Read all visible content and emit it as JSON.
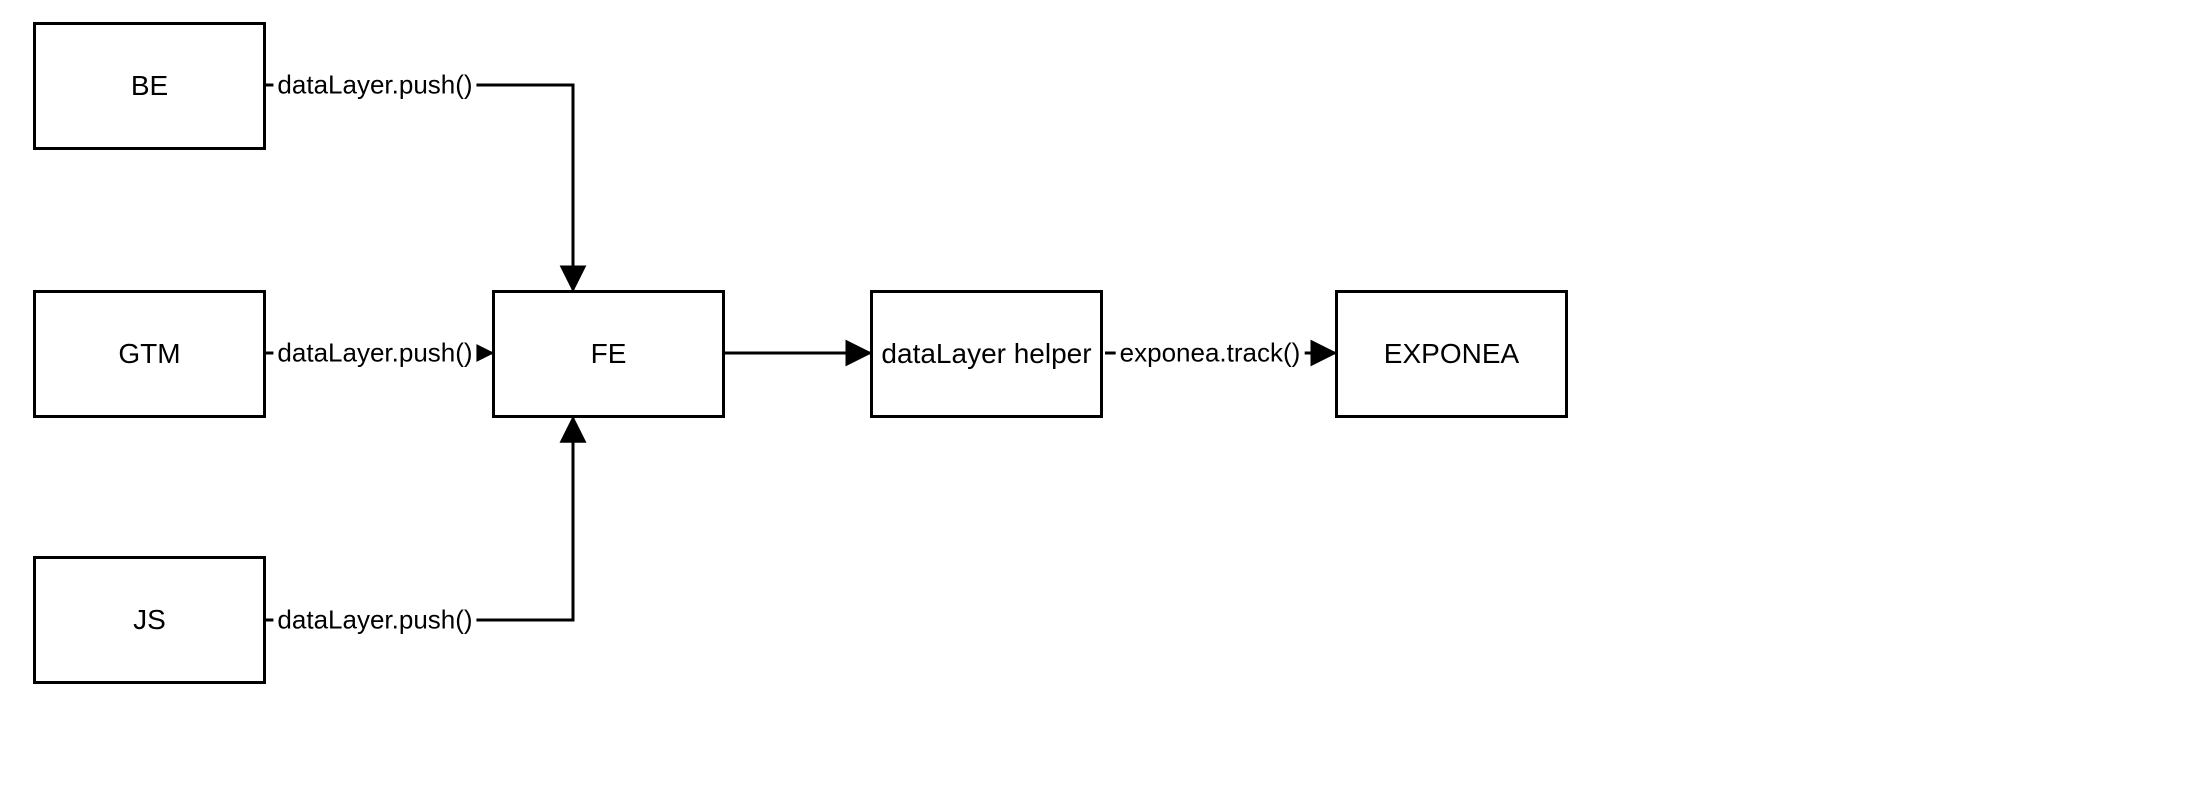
{
  "nodes": {
    "be": {
      "label": "BE"
    },
    "gtm": {
      "label": "GTM"
    },
    "js": {
      "label": "JS"
    },
    "fe": {
      "label": "FE"
    },
    "dlhelper": {
      "label": "dataLayer helper"
    },
    "exponea": {
      "label": "EXPONEA"
    }
  },
  "edges": {
    "be_fe": {
      "label": "dataLayer.push()"
    },
    "gtm_fe": {
      "label": "dataLayer.push()"
    },
    "js_fe": {
      "label": "dataLayer.push()"
    },
    "fe_dlhelper": {
      "label": ""
    },
    "dl_exponea": {
      "label": "exponea.track()"
    }
  }
}
